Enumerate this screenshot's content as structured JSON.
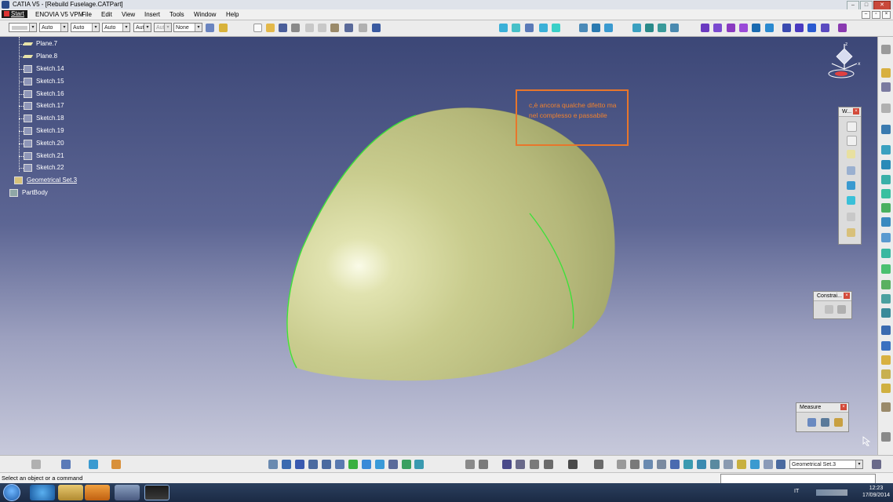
{
  "window": {
    "title": "CATIA V5 - [Rebuild Fuselage.CATPart]",
    "buttons": [
      "minimize-icon",
      "maximize-icon",
      "close-icon"
    ]
  },
  "menu": {
    "start": "Start",
    "items": [
      "ENOVIA V5 VPM",
      "File",
      "Edit",
      "View",
      "Insert",
      "Tools",
      "Window",
      "Help"
    ]
  },
  "toolbar": {
    "combos": [
      "",
      "Auto",
      "Auto",
      "Auto",
      "Aut",
      "Aut",
      "None"
    ]
  },
  "tree": {
    "nodes": [
      "Plane.7",
      "Plane.8",
      "Sketch.14",
      "Sketch.15",
      "Sketch.16",
      "Sketch.17",
      "Sketch.18",
      "Sketch.19",
      "Sketch.20",
      "Sketch.21",
      "Sketch.22"
    ],
    "geometrical_set": "Geometrical Set.3",
    "part_body": "PartBody"
  },
  "annotation": {
    "text": "c,è ancora qualche difetto ma nel complesso e passabile",
    "color": "#f0822e"
  },
  "compass": {
    "z": "z",
    "x": "x"
  },
  "palettes": {
    "wireframe": "W...",
    "constraints": "Constrai...",
    "measure": "Measure"
  },
  "bottom_toolbar": {
    "geometry_selector": "Geometrical Set.3"
  },
  "status": {
    "message": "Select an object or a command"
  },
  "taskbar": {
    "language": "IT",
    "time": "12:23",
    "date": "17/09/2014"
  },
  "colors": {
    "viewport_top": "#3c4777",
    "viewport_bottom": "#c7c9db",
    "surface": "#c9cc8e",
    "edge_highlight": "#3ee03a"
  }
}
